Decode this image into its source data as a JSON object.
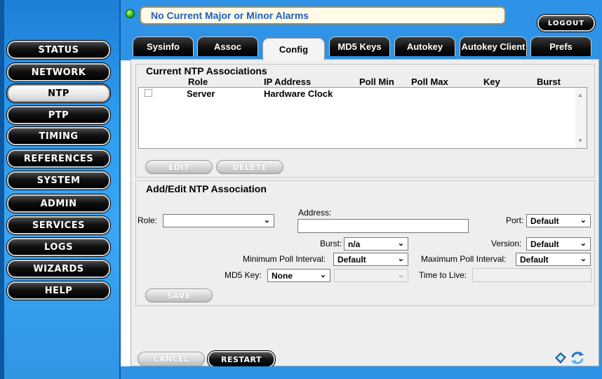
{
  "alarm": {
    "status_text": "No Current Major or Minor Alarms",
    "led_color": "#39c112"
  },
  "header": {
    "logout_label": "LOGOUT"
  },
  "sidebar": {
    "items": [
      {
        "label": "STATUS"
      },
      {
        "label": "NETWORK"
      },
      {
        "label": "NTP",
        "active": true
      },
      {
        "label": "PTP"
      },
      {
        "label": "TIMING"
      },
      {
        "label": "REFERENCES"
      },
      {
        "label": "SYSTEM"
      },
      {
        "label": "ADMIN"
      },
      {
        "label": "SERVICES"
      },
      {
        "label": "LOGS"
      },
      {
        "label": "WIZARDS"
      },
      {
        "label": "HELP"
      }
    ]
  },
  "tabs": [
    {
      "label": "Sysinfo"
    },
    {
      "label": "Assoc"
    },
    {
      "label": "Config",
      "active": true
    },
    {
      "label": "MD5 Keys"
    },
    {
      "label": "Autokey"
    },
    {
      "label": "Autokey Client"
    },
    {
      "label": "Prefs"
    }
  ],
  "associations": {
    "title": "Current NTP Associations",
    "columns": [
      "Role",
      "IP Address",
      "Poll Min",
      "Poll Max",
      "Key",
      "Burst"
    ],
    "rows": [
      {
        "role": "Server",
        "ip_address": "Hardware Clock",
        "poll_min": "",
        "poll_max": "",
        "key": "",
        "burst": ""
      }
    ],
    "edit_label": "EDIT",
    "delete_label": "DELETE"
  },
  "form": {
    "title": "Add/Edit NTP Association",
    "role_label": "Role:",
    "role_value": "",
    "address_label": "Address:",
    "address_value": "",
    "port_label": "Port:",
    "port_value": "Default",
    "burst_label": "Burst:",
    "burst_value": "n/a",
    "version_label": "Version:",
    "version_value": "Default",
    "min_poll_label": "Minimum Poll Interval:",
    "min_poll_value": "Default",
    "max_poll_label": "Maximum Poll Interval:",
    "max_poll_value": "Default",
    "md5_label": "MD5 Key:",
    "md5_value": "None",
    "md5_secondary_value": "",
    "ttl_label": "Time to Live:",
    "ttl_value": "",
    "save_label": "SAVE"
  },
  "footer": {
    "cancel_label": "CANCEL",
    "restart_label": "RESTART"
  },
  "icons": {
    "help_book": "book-icon",
    "refresh": "refresh-icon"
  }
}
